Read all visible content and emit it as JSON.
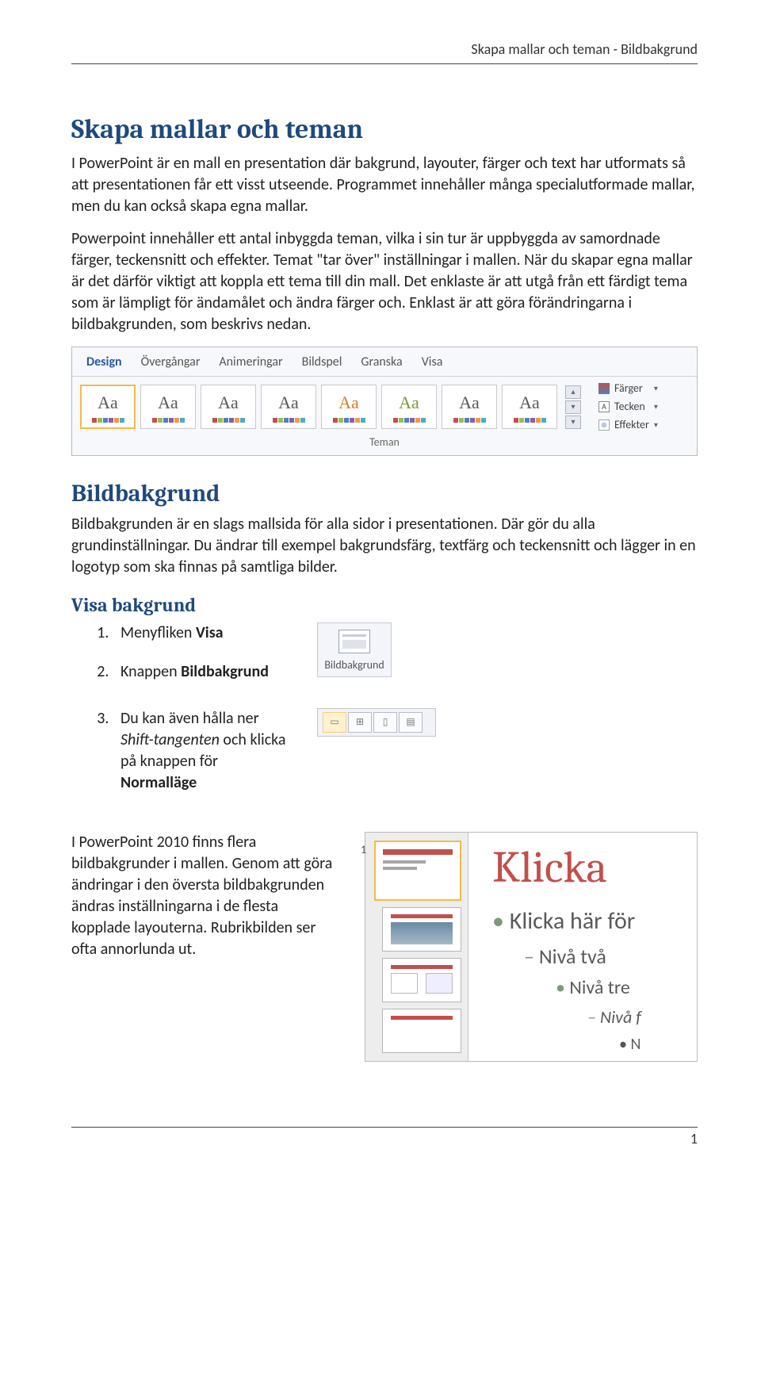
{
  "header": {
    "running": "Skapa mallar och teman - Bildbakgrund"
  },
  "h1": "Skapa mallar och teman",
  "intro": {
    "p1": "I PowerPoint är en mall en presentation där bakgrund, layouter, färger och text har utformats så att presentationen får ett visst utseende. Programmet innehåller många specialutformade mallar, men du kan också skapa egna mallar.",
    "p2a": "Powerpoint innehåller ett antal inbyggda teman, vilka i sin tur är uppbyggda av samordnade färger, teckensnitt och effekter. Temat \"tar över\" inställningar i mallen. När du skapar egna mallar är det därför viktigt att koppla ett tema till din mall. Det enklaste är att utgå från ett färdigt tema som är lämpligt för ändamålet och ändra färger och. Enklast är att göra förändringarna i bildbakgrunden, som beskrivs nedan."
  },
  "ribbon": {
    "tabs": [
      "Design",
      "Övergångar",
      "Animeringar",
      "Bildspel",
      "Granska",
      "Visa"
    ],
    "swatch_label": "Aa",
    "side": {
      "colors": "Färger",
      "fonts": "Tecken",
      "effects": "Effekter"
    },
    "group": "Teman"
  },
  "h2": "Bildbakgrund",
  "bbtext": "Bildbakgrunden är en slags mallsida för alla sidor i presentationen. Där gör du alla grundinställningar. Du ändrar till exempel bakgrundsfärg, textfärg och teckensnitt och lägger in en logotyp som ska finnas på samtliga bilder.",
  "h3": "Visa bakgrund",
  "steps": {
    "s1_pre": "Menyfliken ",
    "s1_b": "Visa",
    "s2_pre": "Knappen ",
    "s2_b": "Bildbakgrund",
    "s3_pre": "Du kan även hålla ner ",
    "s3_i": "Shift-tangenten",
    "s3_mid": " och klicka på knappen för ",
    "s3_b": "Normalläge"
  },
  "btn_bildbak": "Bildbakgrund",
  "master_p": "I PowerPoint 2010 finns flera bildbakgrunder i mallen. Genom att göra ändringar i den översta bildbakgrunden ändras inställningarna i de flesta kopplade layouterna. Rubrikbilden ser ofta annorlunda ut.",
  "master_num": "1",
  "slide": {
    "title": "Klicka",
    "l1": "Klicka här för",
    "l2": "Nivå två",
    "l3": "Nivå tre",
    "l4": "Nivå f",
    "l5": "N"
  },
  "page": "1"
}
